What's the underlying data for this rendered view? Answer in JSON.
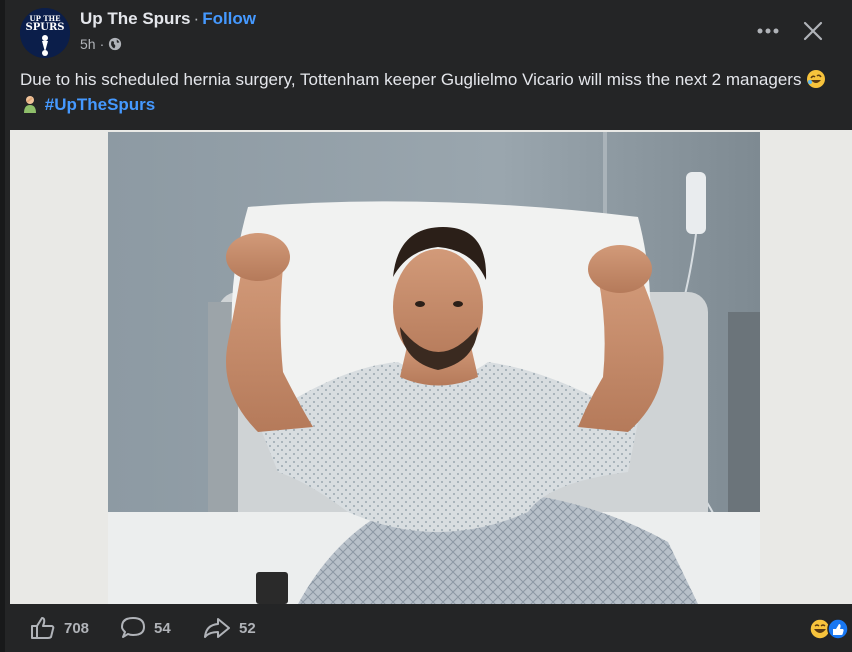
{
  "post": {
    "page_name": "Up The Spurs",
    "separator": "·",
    "follow_label": "Follow",
    "time": "5h",
    "time_separator": "·",
    "avatar_text_1": "UP THE",
    "avatar_text_2": "SPURS"
  },
  "caption": {
    "text": "Due to his scheduled hernia surgery, Tottenham keeper Guglielmo Vicario will miss the next 2 managers",
    "hashtag": "#UpTheSpurs"
  },
  "counts": {
    "likes": "708",
    "comments": "54",
    "shares": "52"
  },
  "icons": {
    "more": "more-horizontal-icon",
    "close": "close-icon",
    "privacy": "globe-icon",
    "like": "thumbs-up-icon",
    "comment": "comment-icon",
    "share": "share-icon"
  },
  "colors": {
    "background": "#242526",
    "text": "#e4e6eb",
    "secondary_text": "#b0b3b8",
    "link": "#4599ff"
  }
}
